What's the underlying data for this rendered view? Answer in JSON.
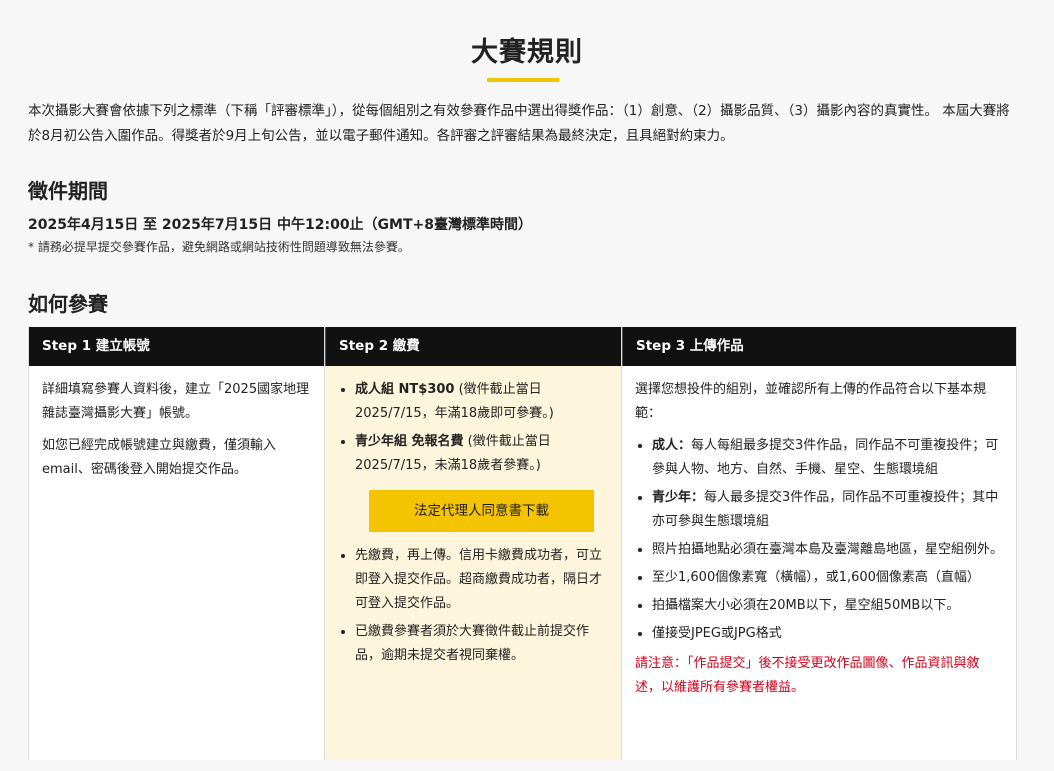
{
  "page_title": "大賽規則",
  "intro": "本次攝影大賽會依據下列之標準（下稱「評審標準」），從每個組別之有效參賽作品中選出得獎作品：（1）創意、（2）攝影品質、（3）攝影內容的真實性。 本屆大賽將於8月初公告入圍作品。得獎者於9月上旬公告，並以電子郵件通知。各評審之評審結果為最終決定，且具絕對約束力。",
  "period": {
    "heading": "徵件期間",
    "dates": "2025年4月15日 至 2025年7月15日 中午12:00止（GMT+8臺灣標準時間）",
    "note": "* 請務必提早提交參賽作品，避免網路或網站技術性問題導致無法參賽。"
  },
  "how": {
    "heading": "如何參賽",
    "steps": [
      {
        "title": "Step 1 建立帳號",
        "paragraphs": [
          "詳細填寫參賽人資料後，建立「2025國家地理雜誌臺灣攝影大賽」帳號。",
          "如您已經完成帳號建立與繳費，僅須輸入email、密碼後登入開始提交作品。"
        ]
      },
      {
        "title": "Step 2 繳費",
        "fees": [
          {
            "label": "成人組 NT$300",
            "detail": " (徵件截止當日2025/7/15，年滿18歲即可參賽。)"
          },
          {
            "label": "青少年組 免報名費",
            "detail": " (徵件截止當日2025/7/15，未滿18歲者參賽。)"
          }
        ],
        "button": "法定代理人同意書下載",
        "notes": [
          "先繳費，再上傳。信用卡繳費成功者，可立即登入提交作品。超商繳費成功者，隔日才可登入提交作品。",
          "已繳費參賽者須於大賽徵件截止前提交作品，逾期未提交者視同棄權。"
        ]
      },
      {
        "title": "Step 3 上傳作品",
        "intro": "選擇您想投件的組別，並確認所有上傳的作品符合以下基本規範：",
        "rules": [
          {
            "label": "成人：",
            "text": "每人每組最多提交3件作品，同作品不可重複投件；可參與人物、地方、自然、手機、星空、生態環境組"
          },
          {
            "label": "青少年：",
            "text": "每人最多提交3件作品，同作品不可重複投件；其中亦可參與生態環境組"
          },
          {
            "label": "",
            "text": "照片拍攝地點必須在臺灣本島及臺灣離島地區，星空組例外。"
          },
          {
            "label": "",
            "text": "至少1,600個像素寬（橫幅），或1,600個像素高（直幅）"
          },
          {
            "label": "",
            "text": "拍攝檔案大小必須在20MB以下，星空組50MB以下。"
          },
          {
            "label": "",
            "text": "僅接受JPEG或JPG格式"
          }
        ],
        "notice": "請注意：「作品提交」後不接受更改作品圖像、作品資訊與敘述，以維護所有參賽者權益。"
      }
    ]
  },
  "colors": {
    "accent": "#f4c400",
    "header_bg": "#111111",
    "notice": "#d0021b",
    "step2_bg": "#fdf6dc"
  }
}
